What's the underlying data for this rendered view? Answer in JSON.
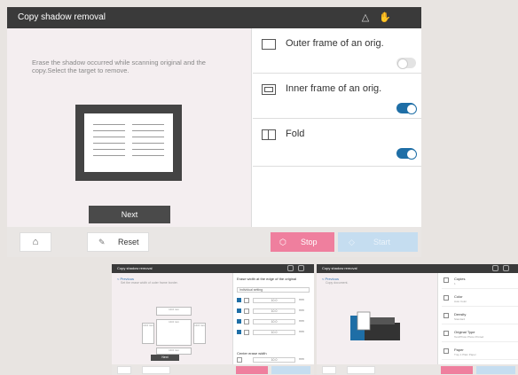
{
  "main": {
    "title": "Copy shadow removal",
    "instructions": "Erase the shadow occurred while scanning original and the copy.Select the target to remove.",
    "next_label": "Next",
    "options": [
      {
        "label": "Outer frame of an orig.",
        "icon": "outer-frame-icon",
        "enabled": false
      },
      {
        "label": "Inner frame of an orig.",
        "icon": "inner-frame-icon",
        "enabled": true
      },
      {
        "label": "Fold",
        "icon": "fold-icon",
        "enabled": true
      }
    ],
    "bottom": {
      "reset_label": "Reset",
      "stop_label": "Stop",
      "start_label": "Start"
    }
  },
  "thumb1": {
    "title": "Copy shadow removal",
    "previous": "< Previous",
    "subtitle": "Set the erase width of outer frame border.",
    "erase_heading": "Erase width at the edge of the original",
    "erase_select": "Individual setting",
    "rows": [
      "10.0",
      "10.0",
      "10.0",
      "10.0"
    ],
    "unit": "mm",
    "cell_value": "10.0 mm",
    "center_label": "Center erase width",
    "center_value": "10.0",
    "next_label": "Next"
  },
  "thumb2": {
    "title": "Copy shadow removal",
    "previous": "< Previous",
    "subtitle": "Copy document.",
    "settings": [
      {
        "name": "Copies",
        "value": "1"
      },
      {
        "name": "Color",
        "value": "Auto Color"
      },
      {
        "name": "Density",
        "value": "Standard"
      },
      {
        "name": "Original Type",
        "value": "Text/Photo Photo Printed"
      },
      {
        "name": "Paper",
        "value": "Tray 1 Plain Paper"
      }
    ]
  },
  "colors": {
    "accent": "#1e6ea6",
    "stop": "#ef7f9e",
    "start": "#c5ddf0",
    "titlebar": "#3a3a3a"
  }
}
